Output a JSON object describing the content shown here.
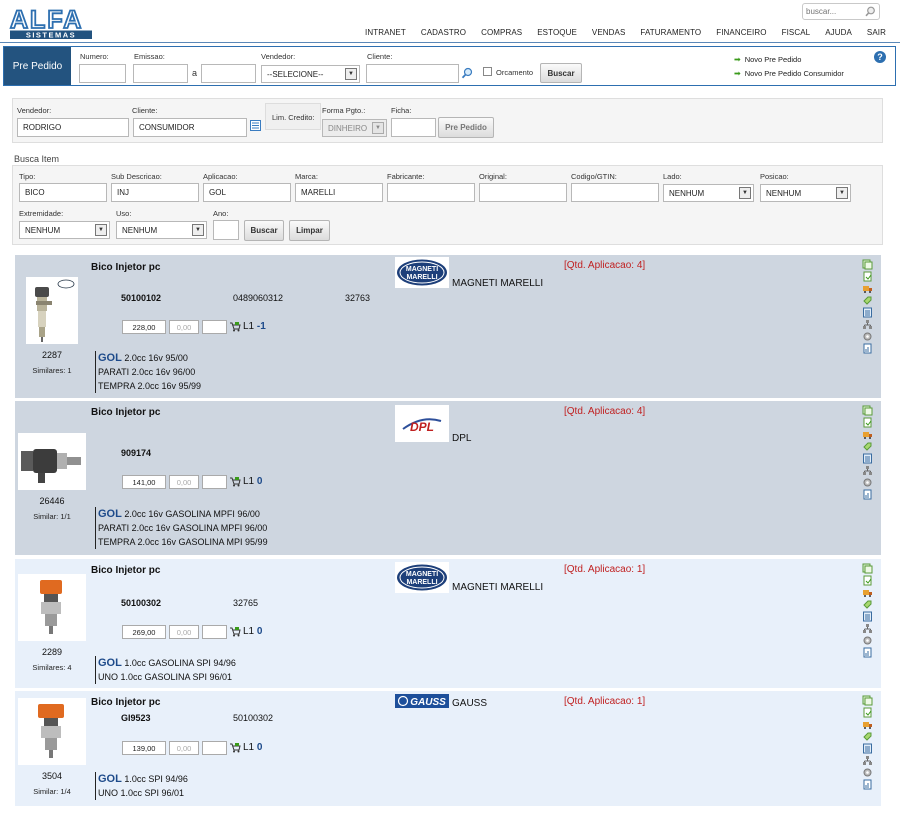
{
  "header": {
    "logo_text": "ALFA",
    "logo_sub": "SISTEMAS",
    "search_placeholder": "buscar...",
    "nav": [
      "INTRANET",
      "CADASTRO",
      "COMPRAS",
      "ESTOQUE",
      "VENDAS",
      "FATURAMENTO",
      "FINANCEIRO",
      "FISCAL",
      "AJUDA",
      "SAIR"
    ]
  },
  "prepedido": {
    "title": "Pre Pedido",
    "numero_label": "Numero:",
    "emissao_label": "Emissao:",
    "a_label": "a",
    "vendedor_label": "Vendedor:",
    "vendedor_value": "--SELECIONE--",
    "cliente_label": "Cliente:",
    "orcamento_label": "Orcamento",
    "buscar_label": "Buscar",
    "links": [
      "Novo Pre Pedido",
      "Novo Pre Pedido Consumidor"
    ],
    "help": "?"
  },
  "order": {
    "vendedor_label": "Vendedor:",
    "vendedor_value": "RODRIGO",
    "cliente_label": "Cliente:",
    "cliente_value": "CONSUMIDOR",
    "lim_credito_label": "Lim. Credito:",
    "forma_pgto_label": "Forma Pgto.:",
    "forma_pgto_value": "DINHEIRO",
    "ficha_label": "Ficha:",
    "pre_pedido_button": "Pre Pedido"
  },
  "busca": {
    "title": "Busca Item",
    "tipo_label": "Tipo:",
    "tipo_value": "BICO",
    "subdesc_label": "Sub Descricao:",
    "subdesc_value": "INJ",
    "aplicacao_label": "Aplicacao:",
    "aplicacao_value": "GOL",
    "marca_label": "Marca:",
    "marca_value": "MARELLI",
    "fabricante_label": "Fabricante:",
    "original_label": "Original:",
    "codigo_label": "Codigo/GTIN:",
    "lado_label": "Lado:",
    "lado_value": "NENHUM",
    "posicao_label": "Posicao:",
    "posicao_value": "NENHUM",
    "extremidade_label": "Extremidade:",
    "extremidade_value": "NENHUM",
    "uso_label": "Uso:",
    "uso_value": "NENHUM",
    "ano_label": "Ano:",
    "buscar_button": "Buscar",
    "limpar_button": "Limpar"
  },
  "results": [
    {
      "name": "Bico Injetor pc",
      "refs": [
        "50100102",
        "0489060312",
        "32763"
      ],
      "brand": "MAGNETI MARELLI",
      "brand_logo": "magneti-marelli",
      "qty_aplicacao": "[Qtd. Aplicacao: 4]",
      "price": "228,00",
      "discount": "0,00",
      "stock_loc": "L1",
      "stock_qty": "-1",
      "code": "2287",
      "similares": "Similares: 1",
      "apps": [
        {
          "vehicle": "GOL",
          "desc": "2.0cc 16v 95/00"
        },
        {
          "vehicle": "",
          "desc": "PARATI 2.0cc 16v 96/00"
        },
        {
          "vehicle": "",
          "desc": "TEMPRA 2.0cc 16v 95/99"
        }
      ]
    },
    {
      "name": "Bico Injetor pc",
      "refs": [
        "909174"
      ],
      "brand": "DPL",
      "brand_logo": "dpl",
      "qty_aplicacao": "[Qtd. Aplicacao: 4]",
      "price": "141,00",
      "discount": "0,00",
      "stock_loc": "L1",
      "stock_qty": "0",
      "code": "26446",
      "similares": "Similar: 1/1",
      "apps": [
        {
          "vehicle": "GOL",
          "desc": "2.0cc 16v GASOLINA MPFI 96/00"
        },
        {
          "vehicle": "",
          "desc": "PARATI 2.0cc 16v GASOLINA MPFI 96/00"
        },
        {
          "vehicle": "",
          "desc": "TEMPRA 2.0cc 16v GASOLINA MPI 95/99"
        }
      ]
    },
    {
      "name": "Bico Injetor pc",
      "refs": [
        "50100302",
        "32765"
      ],
      "brand": "MAGNETI MARELLI",
      "brand_logo": "magneti-marelli",
      "qty_aplicacao": "[Qtd. Aplicacao: 1]",
      "price": "269,00",
      "discount": "0,00",
      "stock_loc": "L1",
      "stock_qty": "0",
      "code": "2289",
      "similares": "Similares: 4",
      "apps": [
        {
          "vehicle": "GOL",
          "desc": "1.0cc GASOLINA SPI 94/96"
        },
        {
          "vehicle": "",
          "desc": "UNO 1.0cc GASOLINA SPI 96/01"
        }
      ]
    },
    {
      "name": "Bico Injetor pc",
      "refs": [
        "GI9523",
        "50100302"
      ],
      "brand": "GAUSS",
      "brand_logo": "gauss",
      "qty_aplicacao": "[Qtd. Aplicacao: 1]",
      "price": "139,00",
      "discount": "0,00",
      "stock_loc": "L1",
      "stock_qty": "0",
      "code": "3504",
      "similares": "Similar: 1/4",
      "apps": [
        {
          "vehicle": "GOL",
          "desc": "1.0cc SPI 94/96"
        },
        {
          "vehicle": "",
          "desc": "UNO 1.0cc SPI 96/01"
        }
      ]
    }
  ],
  "logo_texts": {
    "magneti": "MAGNETI",
    "marelli": "MARELLI",
    "dpl": "DPL",
    "gauss": "GAUSS"
  },
  "colors": {
    "brand_blue": "#23537f",
    "accent_blue": "#2d6fb0",
    "qty_red": "#c02020",
    "row_dark": "#ced6e0",
    "row_light": "#e8f0fa"
  }
}
